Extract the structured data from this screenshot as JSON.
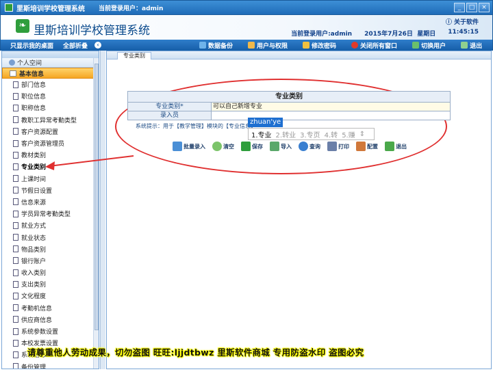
{
  "window": {
    "title": "里斯培训学校管理系统",
    "current_user_label": "当前登录用户：admin",
    "buttons": [
      "_",
      "□",
      "×"
    ]
  },
  "header": {
    "system_name": "里斯培训学校管理系统",
    "about": "关于软件",
    "current_user": "当前登录用户:admin",
    "date": "2015年7月26日",
    "weekday": "星期日",
    "time": "11:45:15"
  },
  "navbar": {
    "show_desktop": "只显示我的桌面",
    "collapse_all": "全部折叠",
    "items": [
      {
        "label": "数据备份",
        "icon_color": "#6fb3ea"
      },
      {
        "label": "用户与权限",
        "icon_color": "#f0b84a"
      },
      {
        "label": "修改密码",
        "icon_color": "#f0c040"
      },
      {
        "label": "关闭所有窗口",
        "icon_color": "#e03a2a"
      },
      {
        "label": "切换用户",
        "icon_color": "#6bc06b"
      },
      {
        "label": "退出",
        "icon_color": "#8fd08f"
      }
    ]
  },
  "sidebar": {
    "personal_space": "个人空间",
    "group": "基本信息",
    "items": [
      "部门信息",
      "职位信息",
      "职称信息",
      "教职工异常考勤类型",
      "客户资源配置",
      "客户资源管理员",
      "教材类别",
      "专业类别",
      "上课时间",
      "节假日设置",
      "信息来源",
      "学员异常考勤类型",
      "就业方式",
      "就业状态",
      "物品类别",
      "银行账户",
      "收入类别",
      "支出类别",
      "文化程度",
      "考勤机信息",
      "供应商信息",
      "系统参数设置",
      "本校发票设置",
      "系统信息",
      "备份管理"
    ],
    "active": "专业类别"
  },
  "content": {
    "tab": "专业类别",
    "form": {
      "title": "专业类别",
      "rows": [
        {
          "label": "专业类别*",
          "value": "可以自己新增专业"
        },
        {
          "label": "录入员",
          "value": ""
        }
      ],
      "hint": "系统提示：用于【教学管理】模块的【专业信息】"
    },
    "ime": {
      "pinyin": "zhuan'ye",
      "candidates": [
        "1.专业",
        "2.转业",
        "3.专页",
        "4.转",
        "5.赚"
      ]
    },
    "toolbar": [
      "批量录入",
      "清空",
      "保存",
      "导入",
      "查询",
      "打印",
      "配置",
      "退出"
    ]
  },
  "watermark": "请尊重他人劳动成果，切勿盗图 旺旺:ljjdtbwz 里斯软件商城 专用防盗水印 盗图必究",
  "colors": {
    "accent": "#1f6cb8",
    "annotation": "#e03030",
    "active_group": "#f5a623"
  }
}
